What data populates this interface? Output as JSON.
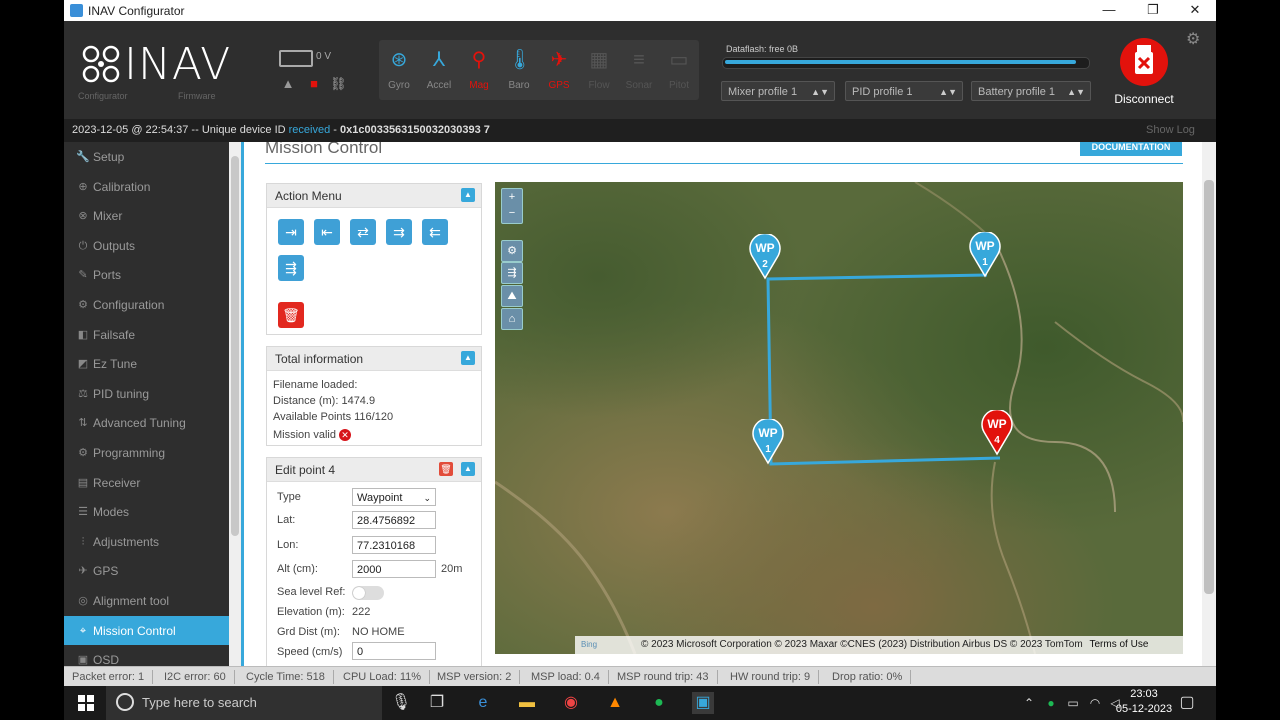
{
  "window": {
    "title": "INAV Configurator",
    "minimize": "—",
    "maximize": "❐",
    "close": "✕"
  },
  "header": {
    "logo_text": "INAV",
    "logo_sub1": "Configurator",
    "logo_sub2": "Firmware",
    "battery_voltage": "0 V",
    "sensors": [
      {
        "label": "Gyro",
        "icon": "gyro-icon",
        "color": "#37a8db"
      },
      {
        "label": "Accel",
        "icon": "accel-icon",
        "color": "#37a8db"
      },
      {
        "label": "Mag",
        "icon": "mag-icon",
        "color": "#e2120c"
      },
      {
        "label": "Baro",
        "icon": "baro-icon",
        "color": "#37a8db"
      },
      {
        "label": "GPS",
        "icon": "gps-icon",
        "color": "#e2120c"
      },
      {
        "label": "Flow",
        "icon": "flow-icon",
        "color": "#555555"
      },
      {
        "label": "Sonar",
        "icon": "sonar-icon",
        "color": "#555555"
      },
      {
        "label": "Pitot",
        "icon": "pitot-icon",
        "color": "#555555"
      }
    ],
    "dataflash": "Dataflash: free 0B",
    "dataflash_fill": 0.98,
    "profiles": [
      "Mixer profile 1",
      "PID profile 1",
      "Battery profile 1"
    ],
    "disconnect_label": "Disconnect"
  },
  "statusline": {
    "timestamp": "2023-12-05 @ 22:54:37",
    "text": " -- Unique device ID ",
    "received": "received",
    "dash": " - ",
    "device_id": "0x1c0033563150032030393 7",
    "show_log": "Show Log"
  },
  "sidebar": {
    "items": [
      {
        "label": "Setup",
        "icon": "wrench-icon"
      },
      {
        "label": "Calibration",
        "icon": "crosshair-icon"
      },
      {
        "label": "Mixer",
        "icon": "mixer-icon"
      },
      {
        "label": "Outputs",
        "icon": "outputs-icon"
      },
      {
        "label": "Ports",
        "icon": "plug-icon"
      },
      {
        "label": "Configuration",
        "icon": "gear-icon"
      },
      {
        "label": "Failsafe",
        "icon": "failsafe-icon"
      },
      {
        "label": "Ez Tune",
        "icon": "eztune-icon"
      },
      {
        "label": "PID tuning",
        "icon": "pid-icon"
      },
      {
        "label": "Advanced Tuning",
        "icon": "advanced-icon"
      },
      {
        "label": "Programming",
        "icon": "programming-icon"
      },
      {
        "label": "Receiver",
        "icon": "receiver-icon"
      },
      {
        "label": "Modes",
        "icon": "modes-icon"
      },
      {
        "label": "Adjustments",
        "icon": "adjustments-icon"
      },
      {
        "label": "GPS",
        "icon": "gps-icon"
      },
      {
        "label": "Alignment tool",
        "icon": "alignment-icon"
      },
      {
        "label": "Mission Control",
        "icon": "location-icon"
      },
      {
        "label": "OSD",
        "icon": "osd-icon"
      }
    ]
  },
  "content": {
    "title": "Mission Control",
    "documentation": "DOCUMENTATION",
    "action_menu": {
      "title": "Action Menu",
      "buttons": [
        "load-file",
        "save-file",
        "load-eeprom",
        "save-eeprom",
        "load-fc",
        "save-fc",
        "delete-all"
      ]
    },
    "total_info": {
      "title": "Total information",
      "filename": "Filename loaded:",
      "distance": "Distance (m): 1474.9",
      "available": "Available Points 116/120",
      "valid": "Mission valid"
    },
    "edit_point": {
      "title": "Edit point 4",
      "type_label": "Type",
      "type_value": "Waypoint",
      "lat_label": "Lat:",
      "lat_value": "28.4756892",
      "lon_label": "Lon:",
      "lon_value": "77.2310168",
      "alt_label": "Alt (cm):",
      "alt_value": "2000",
      "alt_unit": "20m",
      "sea_label": "Sea level Ref:",
      "elev_label": "Elevation (m):",
      "elev_value": "222",
      "grd_label": "Grd Dist (m):",
      "grd_value": "NO HOME",
      "speed_label": "Speed (cm/s)",
      "speed_value": "0"
    },
    "map": {
      "attribution": "© 2023 Microsoft Corporation © 2023 Maxar ©CNES (2023) Distribution Airbus DS © 2023 TomTom",
      "terms": "Terms of Use",
      "bing": "Bing",
      "zoom_in": "+",
      "zoom_out": "−",
      "markers": [
        {
          "label": "WP",
          "num": "2",
          "color": "#37a8db"
        },
        {
          "label": "WP",
          "num": "1",
          "color": "#37a8db"
        },
        {
          "label": "WP",
          "num": "1",
          "color": "#37a8db"
        },
        {
          "label": "WP",
          "num": "4",
          "color": "#e2120c"
        }
      ]
    }
  },
  "footer": {
    "stats": [
      "Packet error: 1",
      "I2C error: 60",
      "Cycle Time: 518",
      "CPU Load: 11%",
      "MSP version: 2",
      "MSP load: 0.4",
      "MSP round trip: 43",
      "HW round trip: 9",
      "Drop ratio: 0%"
    ]
  },
  "taskbar": {
    "search_placeholder": "Type here to search",
    "time": "23:03",
    "date": "05-12-2023"
  }
}
